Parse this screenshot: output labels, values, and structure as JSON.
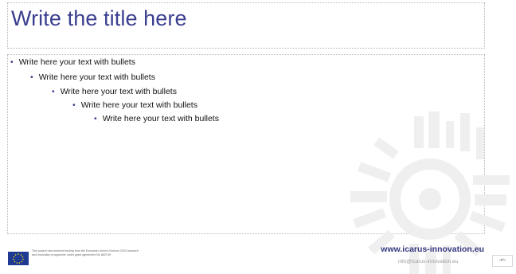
{
  "slide": {
    "title": "Write the title here",
    "bullets": [
      {
        "level": 1,
        "text": "Write here your text with bullets"
      },
      {
        "level": 2,
        "text": "Write here your text with bullets"
      },
      {
        "level": 3,
        "text": "Write here your text with bullets"
      },
      {
        "level": 4,
        "text": "Write here your text with bullets"
      },
      {
        "level": 5,
        "text": "Write here your text with bullets"
      }
    ],
    "bullet_glyph": "•"
  },
  "footer": {
    "funding_text": "This project has received funding from the European Union's Horizon 2020 research and innovation programme under grant agreement No 882749",
    "website": "www.icarus-innovation.eu",
    "email": "info@icarus-innovation.eu",
    "page_number": "‹nº›"
  },
  "colors": {
    "title": "#3b3f8f",
    "website": "#35387f",
    "eu_flag": "#1f3a93",
    "eu_stars": "#ffdd00",
    "decoration": "#eeeeee"
  },
  "icons": {
    "eu_flag": "eu-flag-icon",
    "decoration": "circular-pattern-decoration"
  }
}
